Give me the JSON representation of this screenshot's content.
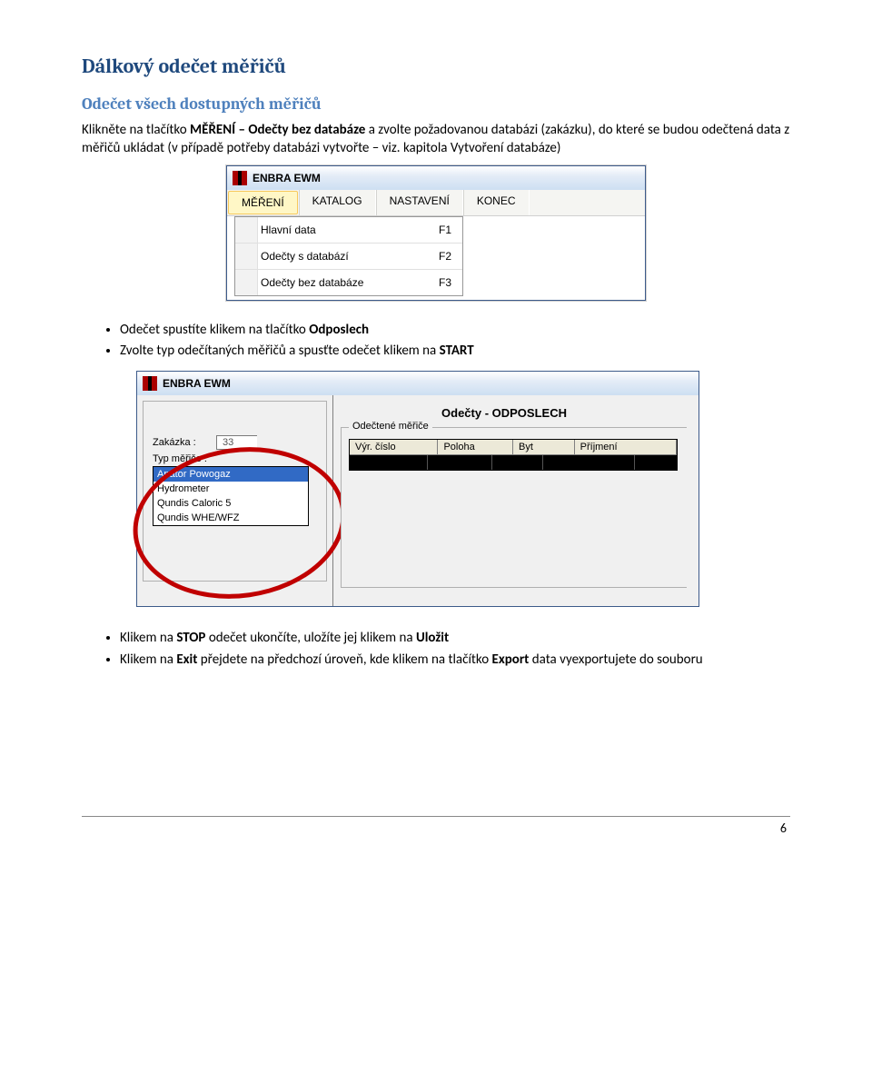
{
  "headings": {
    "h1": "Dálkový odečet měřičů",
    "h2": "Odečet všech dostupných měřičů"
  },
  "paragraphs": {
    "p1a": "Klikněte na tlačítko ",
    "p1b": "MĚŘENÍ – Odečty bez databáze",
    "p1c": " a zvolte požadovanou databázi (zakázku), do které se budou odečtená data z měřičů ukládat (v případě potřeby databázi vytvořte – viz. kapitola Vytvoření databáze)"
  },
  "bullets1": {
    "b1a": "Odečet spustíte klikem na tlačítko ",
    "b1b": "Odposlech",
    "b2a": "Zvolte typ odečítaných měřičů a spusťte odečet klikem na ",
    "b2b": "START"
  },
  "bullets2": {
    "b1a": "Klikem na ",
    "b1b": "STOP",
    "b1c": " odečet ukončíte, uložíte jej klikem na ",
    "b1d": "Uložit",
    "b2a": "Klikem na ",
    "b2b": "Exit",
    "b2c": " přejdete na předchozí úroveň, kde klikem na tlačítko ",
    "b2d": "Export",
    "b2e": " data vyexportujete do souboru"
  },
  "shot1": {
    "title": "ENBRA EWM",
    "menu": [
      "MĚŘENÍ",
      "KATALOG",
      "NASTAVENÍ",
      "KONEC"
    ],
    "dropdown": [
      {
        "label": "Hlavní data",
        "key": "F1"
      },
      {
        "label": "Odečty s databází",
        "key": "F2"
      },
      {
        "label": "Odečty bez databáze",
        "key": "F3"
      }
    ]
  },
  "shot2": {
    "title": "ENBRA EWM",
    "right_title": "Odečty - ODPOSLECH",
    "zakazka_label": "Zakázka :",
    "zakazka_value": "33",
    "typmer_label": "Typ měřiče :",
    "options": [
      "Apator Powogaz",
      "Hydrometer",
      "Qundis Caloric 5",
      "Qundis WHE/WFZ"
    ],
    "group_label": "Odečtené měřiče",
    "columns": [
      "Výr. číslo",
      "Poloha",
      "Byt",
      "Příjmení"
    ]
  },
  "page_number": "6"
}
